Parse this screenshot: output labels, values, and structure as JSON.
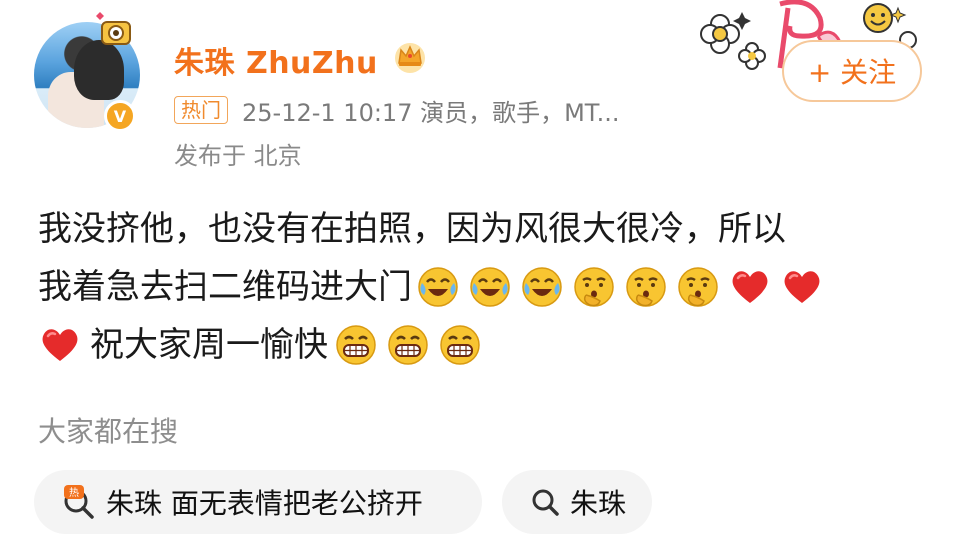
{
  "post": {
    "author": {
      "name": "朱珠 ZhuZhu",
      "avatar_icon": "avatar-photo",
      "verified_icon": "verified-v-icon",
      "crown_icon": "crown-icon"
    },
    "meta": {
      "hot_tag": "热门",
      "time_and_source": "25-12-1 10:17  演员，歌手，MT...",
      "location": "发布于 北京"
    },
    "follow_label": "+ 关注",
    "content_lines": [
      "我没挤他，也没有在拍照，因为风很大很冷，所以",
      "我着急去扫二维码进大门",
      "祝大家周一愉快"
    ],
    "line2_emojis": [
      "laugh-cry-emoji",
      "laugh-cry-emoji",
      "laugh-cry-emoji",
      "thinking-emoji",
      "thinking-emoji",
      "thinking-emoji",
      "heart-emoji",
      "heart-emoji"
    ],
    "line3_lead_emoji": "heart-emoji",
    "line3_trail_emojis": [
      "grin-emoji",
      "grin-emoji",
      "grin-emoji"
    ]
  },
  "search": {
    "title": "大家都在搜",
    "chips": [
      {
        "label": "朱珠 面无表情把老公挤开",
        "icon": "hot-search-icon"
      },
      {
        "label": "朱珠",
        "icon": "search-icon"
      }
    ]
  },
  "colors": {
    "accent": "#f2711c",
    "hot_tag": "#f08a2c",
    "meta": "#7a7a7a",
    "chip_bg": "#f4f4f4"
  }
}
